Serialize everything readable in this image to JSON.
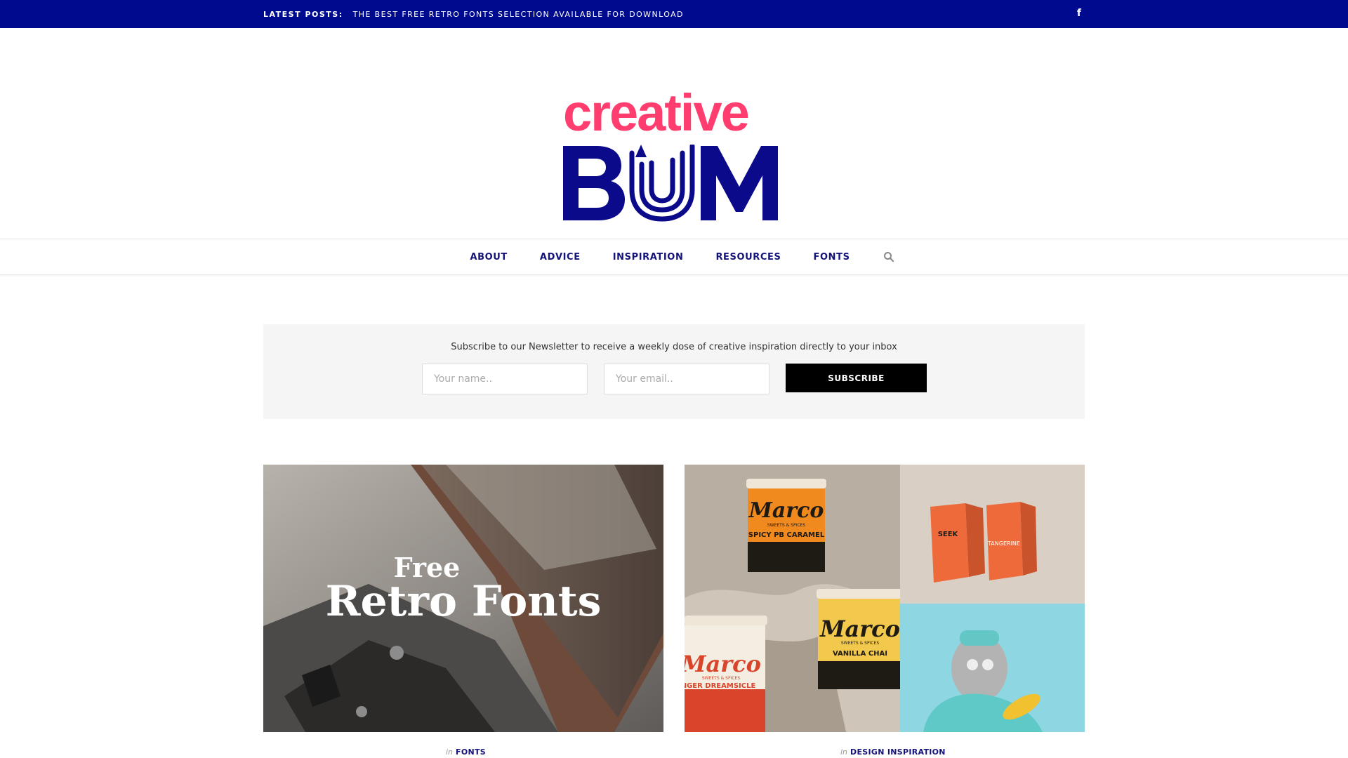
{
  "topbar": {
    "latest_label": "Latest Posts:",
    "latest_link": "The Best Free Retro Fonts Selection Available for Download",
    "social_icon": "facebook-icon"
  },
  "logo": {
    "line1": "creative",
    "line2": "BUM"
  },
  "nav": {
    "items": [
      "ABOUT",
      "ADVICE",
      "INSPIRATION",
      "RESOURCES",
      "FONTS"
    ],
    "search_icon": "search-icon"
  },
  "newsletter": {
    "text": "Subscribe to our Newsletter to receive a weekly dose of creative inspiration directly to your inbox",
    "name_placeholder": "Your name..",
    "email_placeholder": "Your email..",
    "button_label": "SUBSCRIBE"
  },
  "posts": [
    {
      "image_text_1": "Free",
      "image_text_2": "Retro Fonts",
      "in_label": "in",
      "category": "FONTS"
    },
    {
      "in_label": "in",
      "category": "DESIGN INSPIRATION",
      "tub_brand": "Marco",
      "tub_sub": "SWEETS & SPICES",
      "flavor_1": "SPICY PB CARAMEL",
      "flavor_2": "VANILLA CHAI",
      "flavor_3": "NGER DREAMSICLE",
      "carton_brand": "SEEK",
      "carton_flavor": "TANGERINE"
    }
  ],
  "colors": {
    "navy": "#000a8e",
    "pink": "#ff3d6e",
    "nav_text": "#13137a"
  }
}
